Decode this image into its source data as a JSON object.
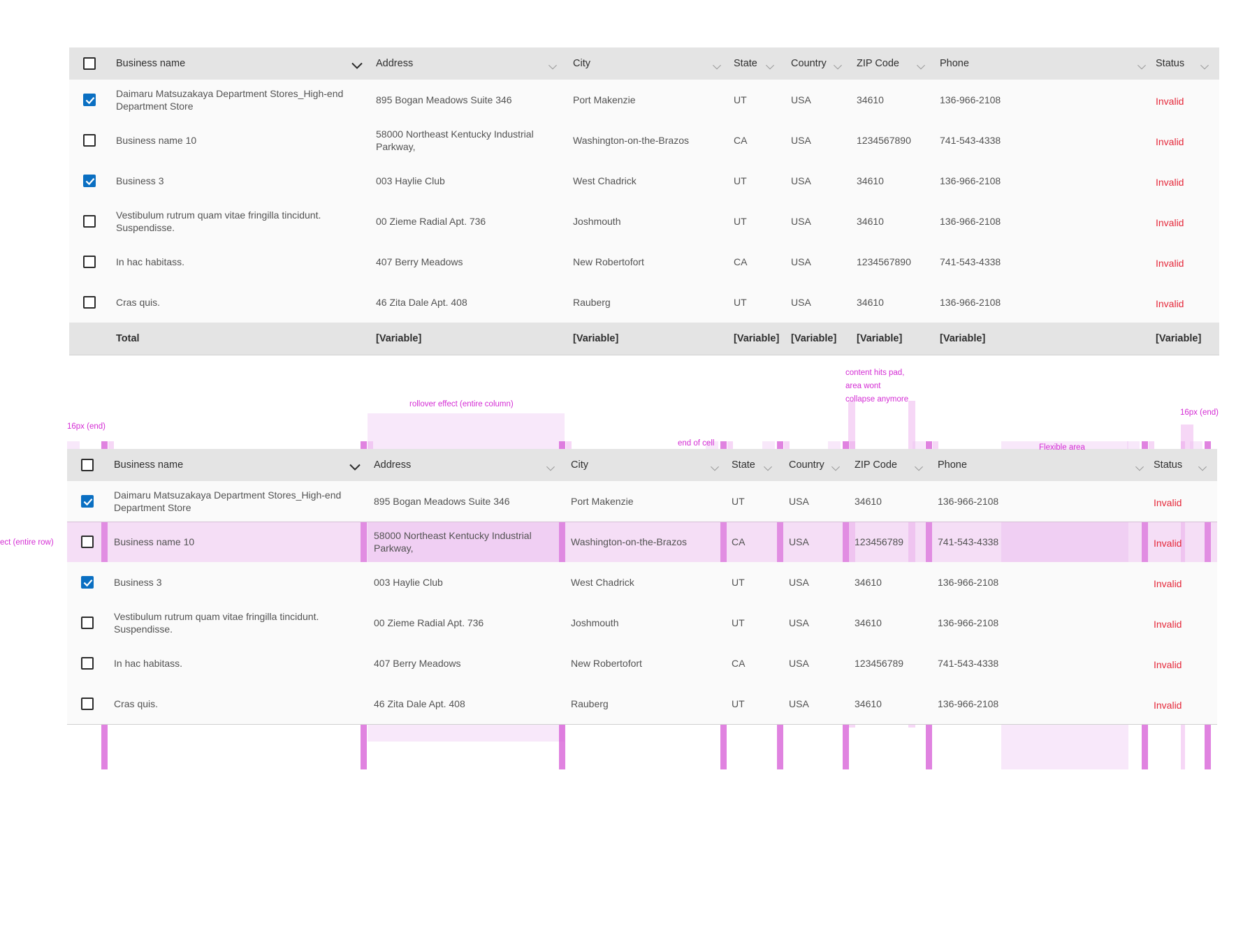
{
  "columns": [
    "Business name",
    "Address",
    "City",
    "State",
    "Country",
    "ZIP Code",
    "Phone",
    "Status"
  ],
  "table1": {
    "rows": [
      {
        "checked": true,
        "name": "Daimaru Matsuzakaya Department Stores_High-end Department Store",
        "address": "895 Bogan Meadows Suite 346",
        "city": "Port Makenzie",
        "state": "UT",
        "country": "USA",
        "zip": "34610",
        "phone": "136-966-2108",
        "status": "Invalid"
      },
      {
        "checked": false,
        "name": "Business name 10",
        "address": "58000 Northeast Kentucky Industrial Parkway,",
        "city": "Washington-on-the-Brazos",
        "state": "CA",
        "country": "USA",
        "zip": "1234567890",
        "phone": "741-543-4338",
        "status": "Invalid"
      },
      {
        "checked": true,
        "name": "Business 3",
        "address": "003 Haylie Club",
        "city": "West Chadrick",
        "state": "UT",
        "country": "USA",
        "zip": "34610",
        "phone": "136-966-2108",
        "status": "Invalid"
      },
      {
        "checked": false,
        "name": "Vestibulum rutrum quam vitae fringilla tincidunt. Suspendisse.",
        "address": "00 Zieme Radial Apt. 736",
        "city": "Joshmouth",
        "state": "UT",
        "country": "USA",
        "zip": "34610",
        "phone": "136-966-2108",
        "status": "Invalid"
      },
      {
        "checked": false,
        "name": "In hac habitass.",
        "address": "407 Berry Meadows",
        "city": "New Robertofort",
        "state": "CA",
        "country": "USA",
        "zip": "1234567890",
        "phone": "741-543-4338",
        "status": "Invalid"
      },
      {
        "checked": false,
        "name": "Cras quis.",
        "address": "46 Zita Dale Apt. 408",
        "city": "Rauberg",
        "state": "UT",
        "country": "USA",
        "zip": "34610",
        "phone": "136-966-2108",
        "status": "Invalid"
      }
    ],
    "total": {
      "label": "Total",
      "address": "[Variable]",
      "city": "[Variable]",
      "state": "[Variable]",
      "country": "[Variable]",
      "zip": "[Variable]",
      "phone": "[Variable]",
      "status": "[Variable]"
    }
  },
  "table2": {
    "rows": [
      {
        "checked": true,
        "name": "Daimaru Matsuzakaya Department Stores_High-end Department Store",
        "address": "895 Bogan Meadows Suite 346",
        "city": "Port Makenzie",
        "state": "UT",
        "country": "USA",
        "zip": "34610",
        "phone": "136-966-2108",
        "status": "Invalid"
      },
      {
        "checked": false,
        "name": "Business name 10",
        "address": "58000 Northeast Kentucky Industrial Parkway,",
        "city": "Washington-on-the-Brazos",
        "state": "CA",
        "country": "USA",
        "zip": "123456789",
        "phone": "741-543-4338",
        "status": "Invalid"
      },
      {
        "checked": true,
        "name": "Business 3",
        "address": "003 Haylie Club",
        "city": "West Chadrick",
        "state": "UT",
        "country": "USA",
        "zip": "34610",
        "phone": "136-966-2108",
        "status": "Invalid"
      },
      {
        "checked": false,
        "name": "Vestibulum rutrum quam vitae fringilla tincidunt. Suspendisse.",
        "address": "00 Zieme Radial Apt. 736",
        "city": "Joshmouth",
        "state": "UT",
        "country": "USA",
        "zip": "34610",
        "phone": "136-966-2108",
        "status": "Invalid"
      },
      {
        "checked": false,
        "name": "In hac habitass.",
        "address": "407 Berry Meadows",
        "city": "New Robertofort",
        "state": "CA",
        "country": "USA",
        "zip": "123456789",
        "phone": "741-543-4338",
        "status": "Invalid"
      },
      {
        "checked": false,
        "name": "Cras quis.",
        "address": "46 Zita Dale Apt. 408",
        "city": "Rauberg",
        "state": "UT",
        "country": "USA",
        "zip": "34610",
        "phone": "136-966-2108",
        "status": "Invalid"
      }
    ]
  },
  "annotations": {
    "pad_start": "16px (end)",
    "column_hover": "rollover effect (entire column)",
    "end_of_cell": "end of cell",
    "content_pad": [
      "content hits pad,",
      "area wont",
      "collapse anymore"
    ],
    "pad_end": "16px (end)",
    "flexible": "Flexible area",
    "row_hover": "ect (entire row)"
  },
  "colors": {
    "header_bg": "#e4e4e4",
    "checkbox_checked": "#0a6fc2",
    "status_invalid": "#e5283a",
    "annotation": "#d42cd4"
  }
}
